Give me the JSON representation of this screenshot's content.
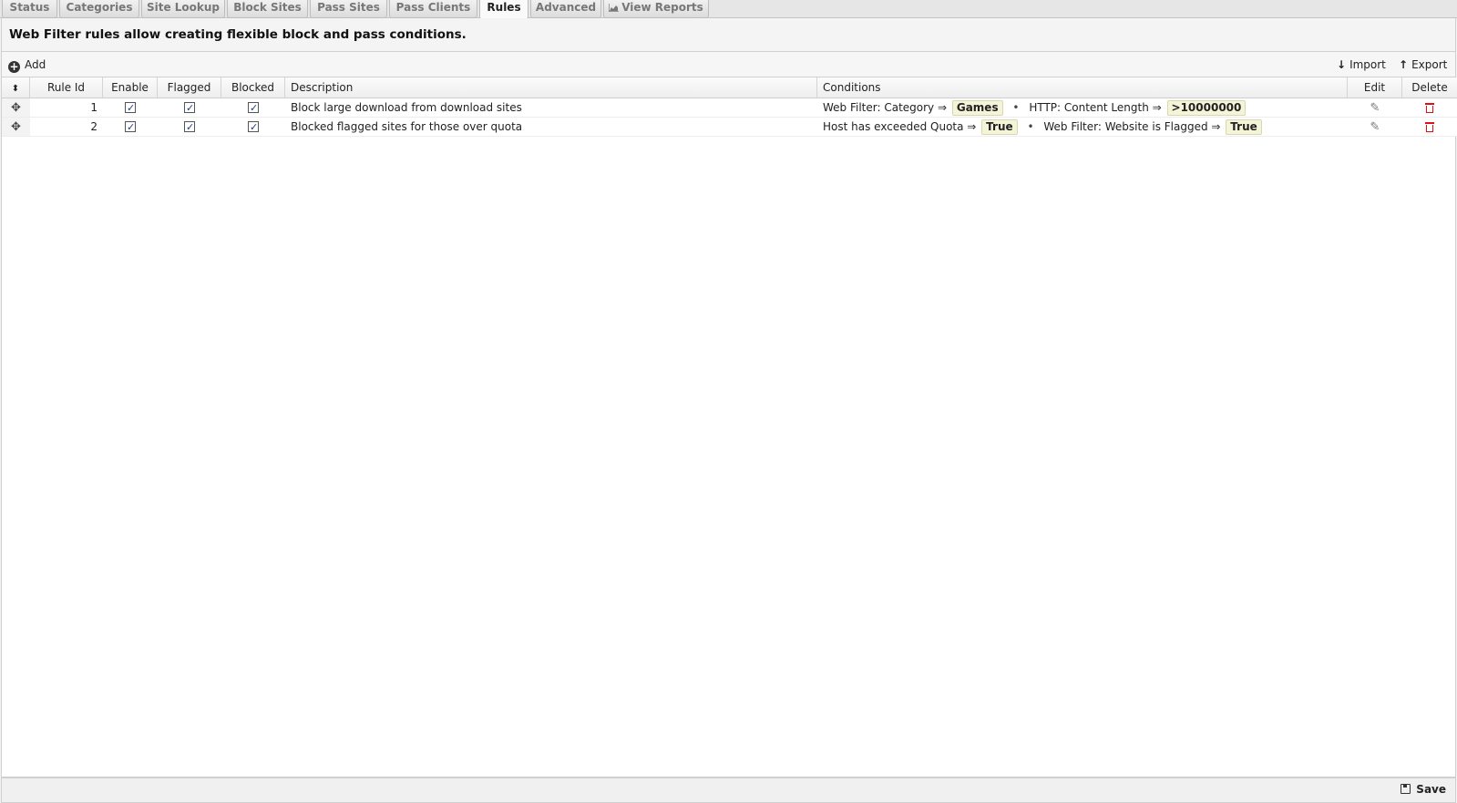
{
  "tabs": [
    {
      "label": "Status",
      "active": false
    },
    {
      "label": "Categories",
      "active": false
    },
    {
      "label": "Site Lookup",
      "active": false
    },
    {
      "label": "Block Sites",
      "active": false
    },
    {
      "label": "Pass Sites",
      "active": false
    },
    {
      "label": "Pass Clients",
      "active": false
    },
    {
      "label": "Rules",
      "active": true
    },
    {
      "label": "Advanced",
      "active": false
    },
    {
      "label": "View Reports",
      "active": false,
      "icon": "chart-icon"
    }
  ],
  "header": {
    "message": "Web Filter rules allow creating flexible block and pass conditions."
  },
  "toolbar": {
    "add_label": "Add",
    "import_label": "Import",
    "export_label": "Export"
  },
  "grid": {
    "columns": {
      "rule_id": "Rule Id",
      "enable": "Enable",
      "flagged": "Flagged",
      "blocked": "Blocked",
      "description": "Description",
      "conditions": "Conditions",
      "edit": "Edit",
      "delete": "Delete"
    },
    "rows": [
      {
        "id": "1",
        "enable": true,
        "flagged": true,
        "blocked": true,
        "description": "Block large download from download sites",
        "conditions": [
          {
            "label": "Web Filter: Category ⇒",
            "value": "Games"
          },
          {
            "label": "HTTP: Content Length ⇒",
            "value": ">10000000"
          }
        ]
      },
      {
        "id": "2",
        "enable": true,
        "flagged": true,
        "blocked": true,
        "description": "Blocked flagged sites for those over quota",
        "conditions": [
          {
            "label": "Host has exceeded Quota ⇒",
            "value": "True"
          },
          {
            "label": "Web Filter: Website is Flagged ⇒",
            "value": "True"
          }
        ]
      }
    ],
    "separator": "•"
  },
  "footer": {
    "save_label": "Save"
  },
  "colors": {
    "delete_red": "#dd1111",
    "value_bg": "#f4f4d8",
    "checkbox_tick": "#1a3d8c"
  }
}
